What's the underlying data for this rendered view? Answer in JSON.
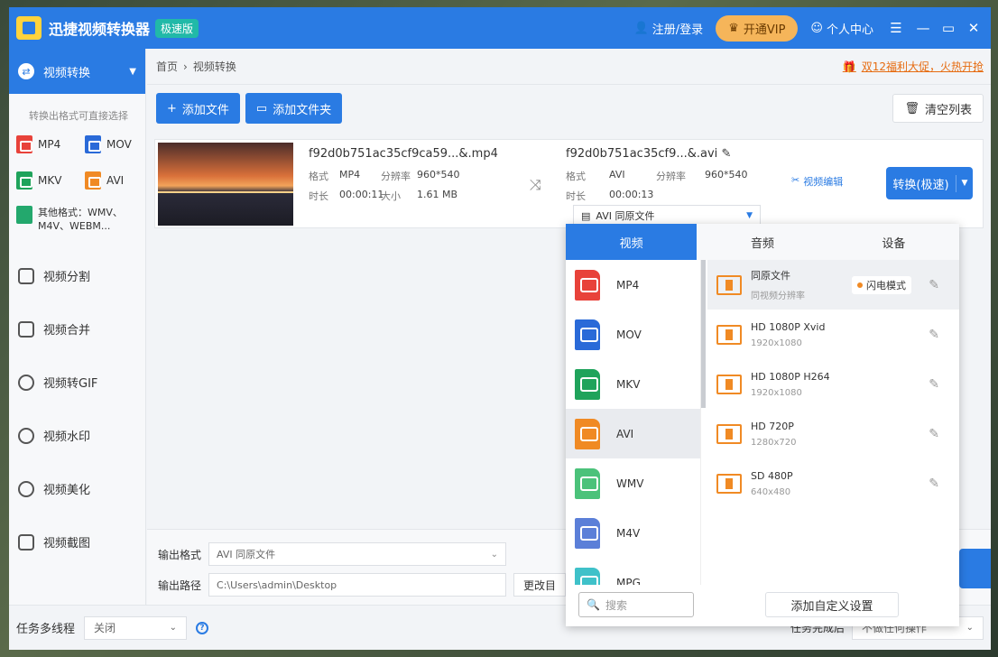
{
  "app": {
    "title": "迅捷视频转换器",
    "edition": "极速版",
    "login": "注册/登录",
    "vip": "开通VIP",
    "personal": "个人中心"
  },
  "colors": {
    "accent": "#2a7be3",
    "vip": "#f5b55a",
    "promo": "#e66b10"
  },
  "sidebar": {
    "header": "视频转换",
    "sub": "转换出格式可直接选择",
    "formats": [
      {
        "label": "MP4",
        "color": "#e8423a"
      },
      {
        "label": "MOV",
        "color": "#2a6ad8"
      },
      {
        "label": "MKV",
        "color": "#1fa35b"
      },
      {
        "label": "AVI",
        "color": "#f08a24"
      }
    ],
    "other_formats": "其他格式：WMV、M4V、WEBM...",
    "menu": [
      {
        "label": "视频分割",
        "icon": "scissors-icon"
      },
      {
        "label": "视频合并",
        "icon": "merge-icon"
      },
      {
        "label": "视频转GIF",
        "icon": "gif-icon"
      },
      {
        "label": "视频水印",
        "icon": "watermark-icon"
      },
      {
        "label": "视频美化",
        "icon": "beautify-icon"
      },
      {
        "label": "视频截图",
        "icon": "screenshot-icon"
      }
    ]
  },
  "main": {
    "breadcrumb_home": "首页",
    "breadcrumb_current": "视频转换",
    "promo": "双12福利大促，火热开抢",
    "add_file": "添加文件",
    "add_folder": "添加文件夹",
    "clear_list": "清空列表"
  },
  "file": {
    "src_name": "f92d0b751ac35cf9ca59...&.mp4",
    "src_format_label": "格式",
    "src_format": "MP4",
    "src_res_label": "分辨率",
    "src_res": "960*540",
    "src_dur_label": "时长",
    "src_dur": "00:00:11",
    "src_size_label": "大小",
    "src_size": "1.61 MB",
    "dst_name": "f92d0b751ac35cf9...&.avi",
    "dst_format_label": "格式",
    "dst_format": "AVI",
    "dst_res_label": "分辨率",
    "dst_res": "960*540",
    "dst_dur_label": "时长",
    "dst_dur": "00:00:13",
    "dst_select": "AVI  同原文件",
    "edit_video": "视频编辑",
    "convert": "转换(极速)"
  },
  "bottom": {
    "out_format_label": "输出格式",
    "out_format": "AVI  同原文件",
    "out_path_label": "输出路径",
    "out_path": "C:\\Users\\admin\\Desktop",
    "change_dir": "更改目"
  },
  "status": {
    "multitask_label": "任务多线程",
    "multitask_value": "关闭",
    "done_label": "任务完成后",
    "done_value": "不做任何操作"
  },
  "popup": {
    "tabs": [
      "视频",
      "音频",
      "设备"
    ],
    "formats": [
      {
        "label": "MP4",
        "color": "#e8423a"
      },
      {
        "label": "MOV",
        "color": "#2a6ad8"
      },
      {
        "label": "MKV",
        "color": "#1fa35b"
      },
      {
        "label": "AVI",
        "color": "#f08a24"
      },
      {
        "label": "WMV",
        "color": "#4bc27a"
      },
      {
        "label": "M4V",
        "color": "#5b7fd8"
      },
      {
        "label": "MPG",
        "color": "#3fc1c9"
      }
    ],
    "presets": [
      {
        "name": "同原文件",
        "detail": "同视频分辨率",
        "tag": "闪电模式"
      },
      {
        "name": "HD 1080P Xvid",
        "detail": "1920x1080",
        "tag": ""
      },
      {
        "name": "HD 1080P H264",
        "detail": "1920x1080",
        "tag": ""
      },
      {
        "name": "HD 720P",
        "detail": "1280x720",
        "tag": ""
      },
      {
        "name": "SD 480P",
        "detail": "640x480",
        "tag": ""
      }
    ],
    "search_placeholder": "搜索",
    "custom_button": "添加自定义设置"
  }
}
